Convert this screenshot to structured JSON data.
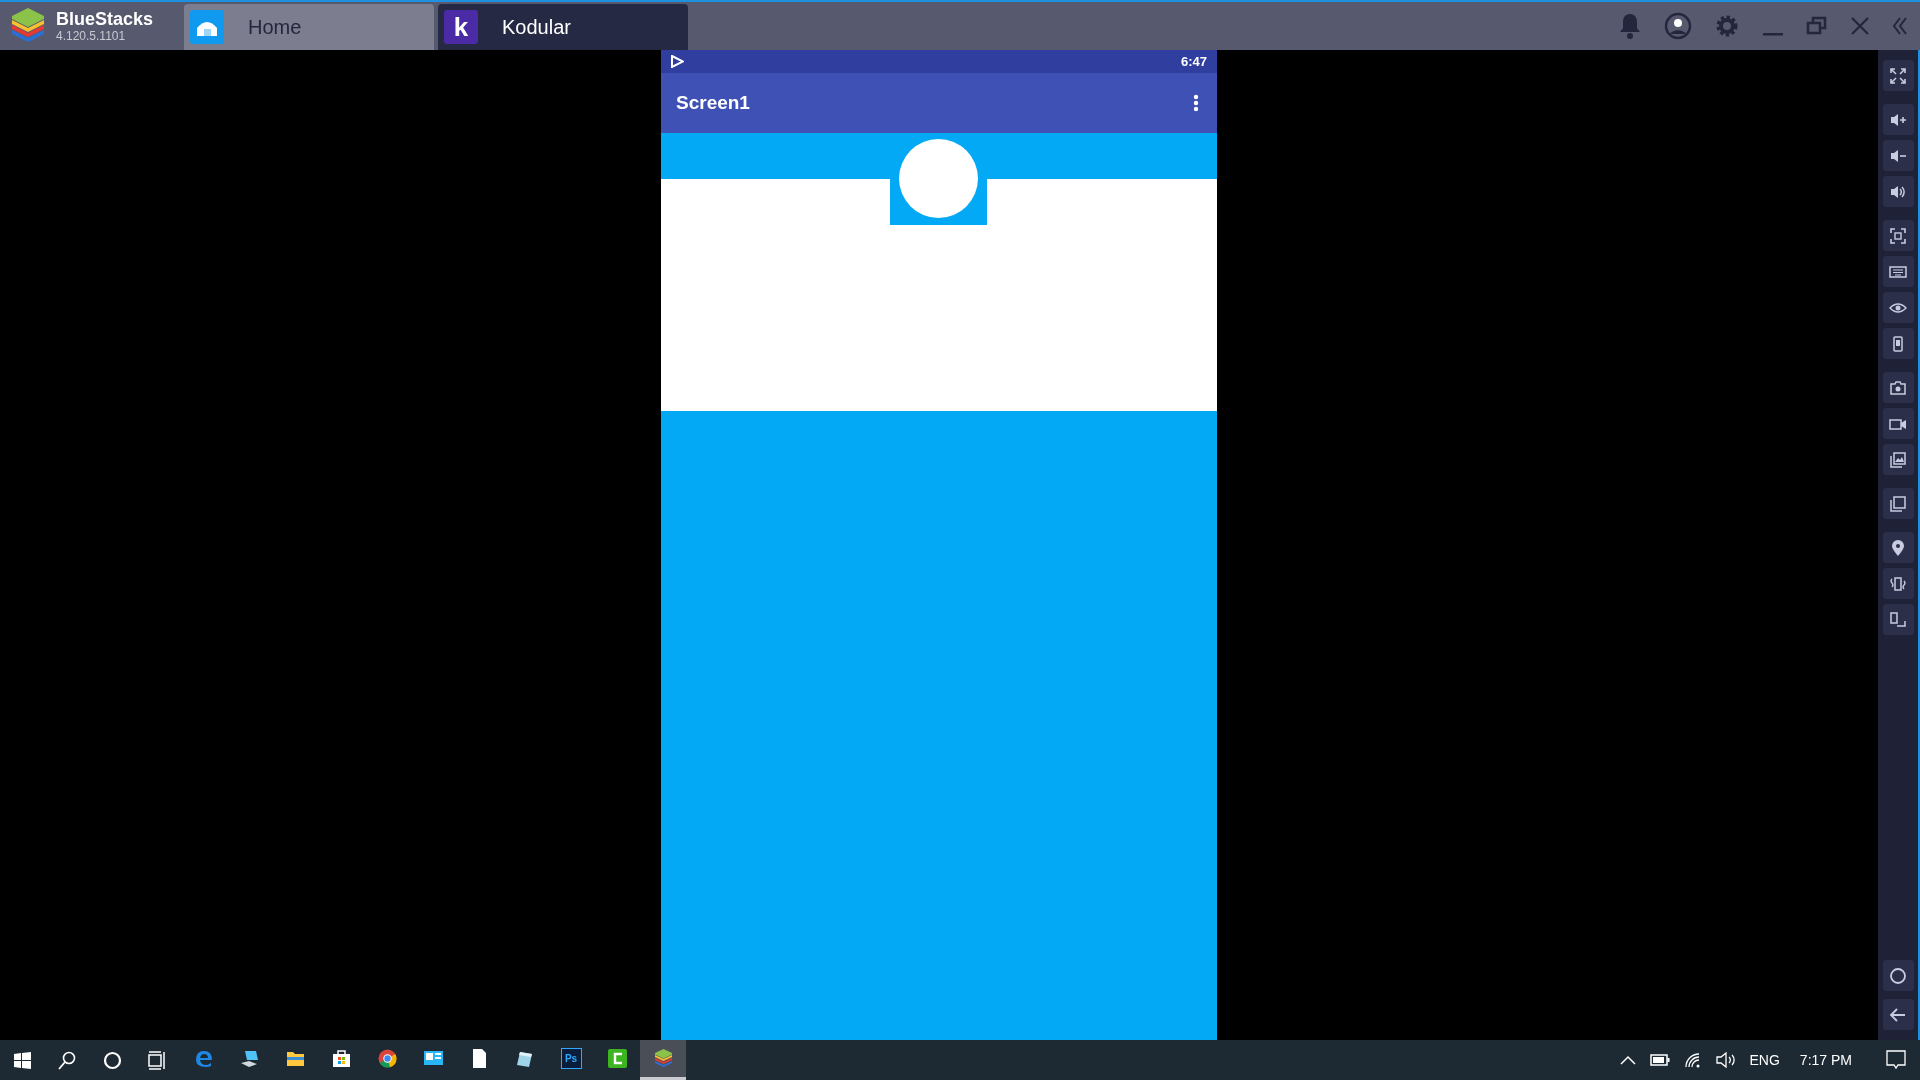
{
  "app": {
    "name": "BlueStacks",
    "version": "4.120.5.1101"
  },
  "tabs": [
    {
      "label": "Home",
      "kind": "home",
      "selected": false
    },
    {
      "label": "Kodular",
      "kind": "kodular",
      "logo_letter": "k",
      "selected": true
    }
  ],
  "phone": {
    "status_time": "6:47",
    "app_bar_title": "Screen1"
  },
  "taskbar": {
    "apps": [
      {
        "kind": "edge",
        "selected": false
      },
      {
        "kind": "pc",
        "selected": false
      },
      {
        "kind": "folder",
        "selected": false
      },
      {
        "kind": "store",
        "selected": false
      },
      {
        "kind": "chrome",
        "selected": false
      },
      {
        "kind": "panel",
        "selected": false
      },
      {
        "kind": "file",
        "selected": false
      },
      {
        "kind": "notes",
        "selected": false
      },
      {
        "kind": "photoshop",
        "label": "Ps",
        "selected": false
      },
      {
        "kind": "camtasia",
        "selected": false
      },
      {
        "kind": "bluestacks",
        "selected": true
      }
    ],
    "language": "ENG",
    "clock": "7:17 PM"
  }
}
